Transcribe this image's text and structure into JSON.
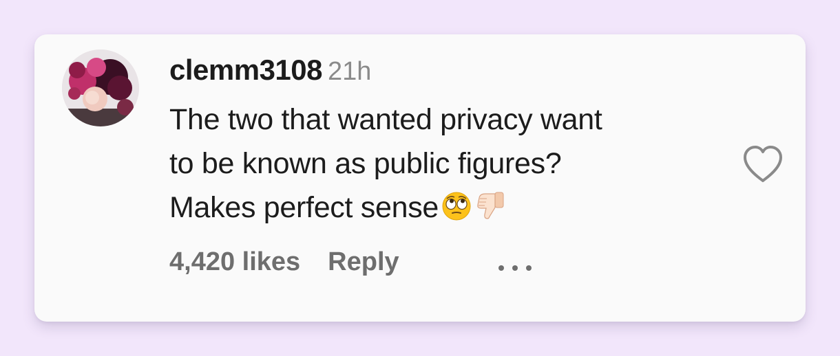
{
  "comment": {
    "username": "clemm3108",
    "timestamp": "21h",
    "lines": [
      "The two that wanted privacy want",
      "to be known as public figures?",
      "Makes perfect sense"
    ],
    "emojis": [
      "face-with-rolling-eyes",
      "thumbs-down-light-skin"
    ],
    "likes_label": "4,420 likes",
    "reply_label": "Reply",
    "more_icon": "more-dots-icon",
    "like_icon": "heart-outline-icon"
  },
  "colors": {
    "page_background": "#f2e6fb",
    "card_background": "#fafafa",
    "text_primary": "#1c1c1c",
    "text_secondary": "#8a8a8a",
    "footer_text": "#6e6e6e"
  }
}
